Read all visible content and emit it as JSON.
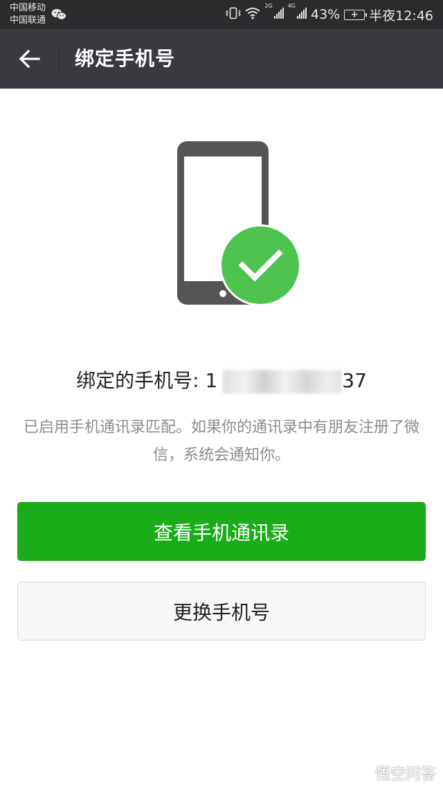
{
  "status_bar": {
    "carrier_1": "中国移动",
    "carrier_2": "中国联通",
    "net_1": "2G",
    "net_2": "4G",
    "battery": "43%",
    "time": "半夜12:46",
    "notification_icon": "wechat-icon"
  },
  "app_bar": {
    "back_icon": "arrow-left-icon",
    "title": "绑定手机号"
  },
  "illustration": {
    "icon": "phone-with-check-icon",
    "check_color": "#4fc34f",
    "phone_color": "#555555"
  },
  "content": {
    "bound_label": "绑定的手机号:",
    "bound_number_start": "1",
    "bound_number_end": "37",
    "description": "已启用手机通讯录匹配。如果你的通讯录中有朋友注册了微信，系统会通知你。"
  },
  "buttons": {
    "view_contacts": "查看手机通讯录",
    "change_number": "更换手机号"
  },
  "colors": {
    "primary": "#1aad19",
    "app_bar": "#393a3f",
    "status_bar": "#2b2b2d"
  },
  "watermark": {
    "text": "悟空问答"
  }
}
